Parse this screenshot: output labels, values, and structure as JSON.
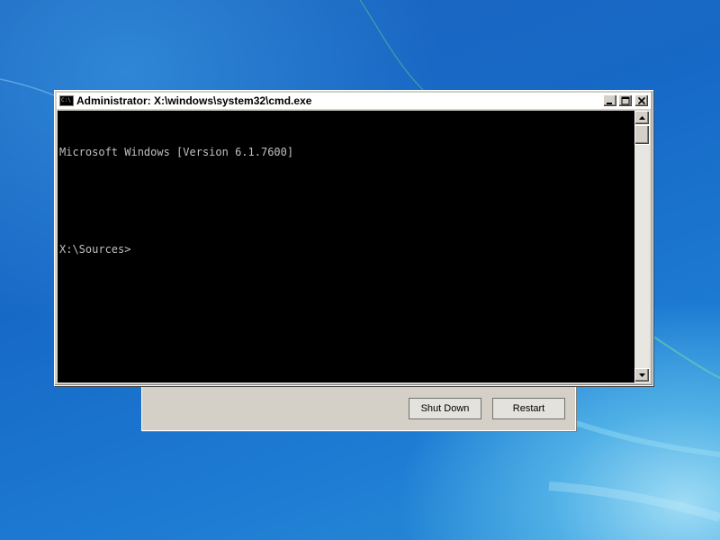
{
  "colors": {
    "console_bg": "#000000",
    "console_text": "#c0c0c0",
    "window_chrome": "#d4d0c8",
    "desktop_blue": "#1769c7"
  },
  "cmd_window": {
    "title": "Administrator: X:\\windows\\system32\\cmd.exe",
    "icon": "cmd-icon",
    "icon_text": "C:\\",
    "caption_buttons": [
      "minimize",
      "maximize",
      "close"
    ],
    "console_lines": [
      "Microsoft Windows [Version 6.1.7600]",
      "",
      "X:\\Sources>"
    ]
  },
  "recovery_dialog": {
    "shutdown_label": "Shut Down",
    "restart_label": "Restart"
  }
}
